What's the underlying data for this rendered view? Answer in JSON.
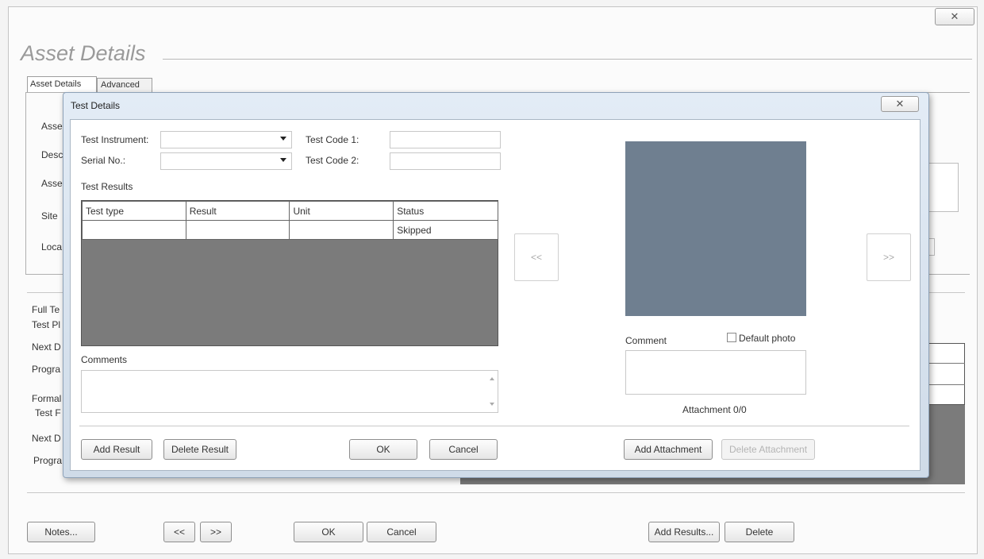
{
  "outer": {
    "title": "Asset Details",
    "close_glyph": "✕",
    "tabs": [
      {
        "label": "Asset Details"
      },
      {
        "label": "Advanced"
      }
    ],
    "left_labels": [
      "Asse",
      "Desc",
      "Asse",
      "Site",
      "Loca"
    ],
    "lower_labels": [
      "Full Te",
      "Test Pl",
      "Next D",
      "Progra",
      "Formal",
      "Test F",
      "Next D",
      "Progra"
    ],
    "buttons": {
      "notes": "Notes...",
      "prev": "<<",
      "next": ">>",
      "ok": "OK",
      "cancel": "Cancel",
      "add_results": "Add Results...",
      "delete": "Delete"
    }
  },
  "dialog": {
    "title": "Test Details",
    "close_glyph": "✕",
    "fields": {
      "test_instrument_label": "Test Instrument:",
      "test_instrument_value": "",
      "serial_label": "Serial No.:",
      "serial_value": "",
      "code1_label": "Test Code 1:",
      "code1_value": "",
      "code2_label": "Test Code 2:",
      "code2_value": ""
    },
    "results_label": "Test Results",
    "results_table": {
      "columns": [
        "Test type",
        "Result",
        "Unit",
        "Status"
      ],
      "rows": [
        [
          "",
          "",
          "",
          "Skipped"
        ]
      ]
    },
    "comments_label": "Comments",
    "comments_value": "",
    "photo": {
      "prev": "<<",
      "next": ">>",
      "comment_label": "Comment",
      "default_photo_label": "Default photo",
      "default_photo_checked": false,
      "attachment_count": "Attachment 0/0",
      "placeholder_color": "#6f7f90"
    },
    "buttons": {
      "add_result": "Add Result",
      "delete_result": "Delete Result",
      "ok": "OK",
      "cancel": "Cancel",
      "add_attachment": "Add Attachment",
      "delete_attachment": "Delete Attachment"
    }
  }
}
